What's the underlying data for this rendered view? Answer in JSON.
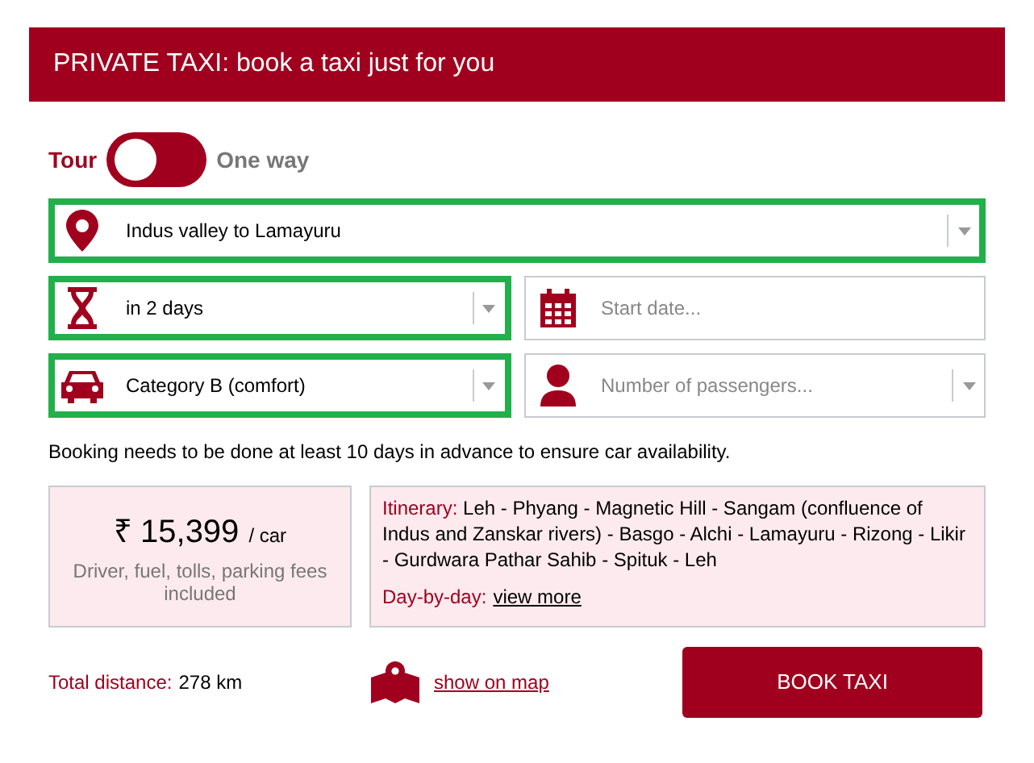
{
  "header": {
    "title": "PRIVATE TAXI: book a taxi just for you"
  },
  "trip_type": {
    "options": [
      {
        "label": "Tour",
        "selected": true
      },
      {
        "label": "One way",
        "selected": false
      }
    ]
  },
  "fields": [
    {
      "kind": "location",
      "value": "Indus valley to Lamayuru",
      "dropdown": true,
      "highlighted": true
    },
    {
      "kind": "duration",
      "value": "in 2 days",
      "dropdown": true,
      "highlighted": true
    },
    {
      "kind": "date",
      "placeholder": "Start date...",
      "dropdown": false,
      "highlighted": false
    },
    {
      "kind": "car",
      "value": "Category B (comfort)",
      "dropdown": true,
      "highlighted": true
    },
    {
      "kind": "passengers",
      "placeholder": "Number of passengers...",
      "dropdown": true,
      "highlighted": false
    }
  ],
  "notice": "Booking needs to be done at least 10 days in advance to ensure car availability.",
  "price": {
    "amount": "₹ 15,399",
    "unit": "/ car",
    "note": "Driver, fuel, tolls, parking fees included"
  },
  "itinerary": {
    "label": "Itinerary:",
    "text": "Leh - Phyang - Magnetic Hill - Sangam (confluence of Indus and Zanskar rivers) - Basgo - Alchi - Lamayuru - Rizong - Likir - Gurdwara Pathar Sahib - Spituk - Leh",
    "day_label": "Day-by-day:",
    "day_link": "view more"
  },
  "distance": {
    "label": "Total distance:",
    "value": "278 km"
  },
  "map_link": "show on map",
  "book_button": "BOOK TAXI"
}
